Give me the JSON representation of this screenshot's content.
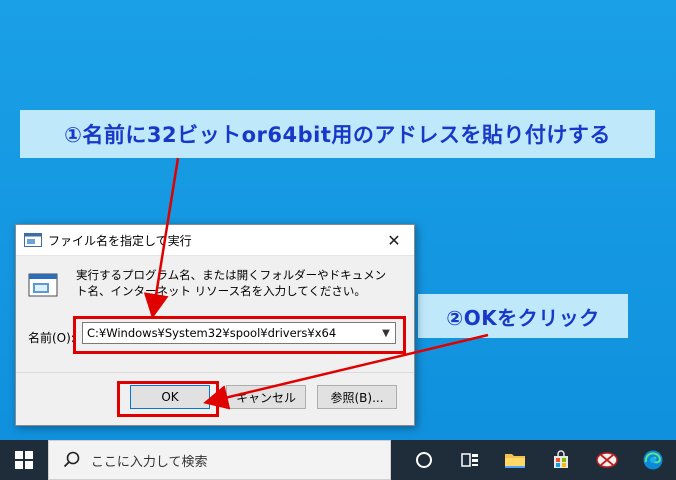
{
  "annotations": {
    "step1": "①名前に32ビットor64bit用のアドレスを貼り付けする",
    "step2": "②OKをクリック"
  },
  "dialog": {
    "title": "ファイル名を指定して実行",
    "close_label": "✕",
    "description": "実行するプログラム名、または開くフォルダーやドキュメント名、インターネット リソース名を入力してください。",
    "open_label": "名前(O):",
    "open_value": "C:¥Windows¥System32¥spool¥drivers¥x64",
    "ok_label": "OK",
    "cancel_label": "キャンセル",
    "browse_label": "参照(B)..."
  },
  "taskbar": {
    "search_placeholder": "ここに入力して検索",
    "icons": [
      "windows-start-icon",
      "search-icon",
      "cortana-icon",
      "task-view-icon",
      "file-explorer-icon",
      "store-icon",
      "snipping-tool-icon",
      "edge-icon"
    ]
  },
  "colors": {
    "desktop": "#1aa0e6",
    "banner_bg": "#bfe9fb",
    "banner_text": "#1738c8",
    "highlight": "#e00000",
    "taskbar": "#1f2d3a"
  }
}
